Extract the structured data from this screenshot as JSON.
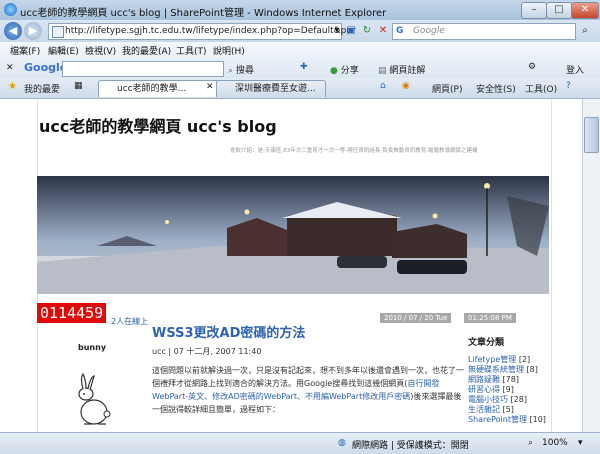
{
  "window": {
    "title": "ucc老師的教學網頁 ucc's blog | SharePoint管理 - Windows Internet Explorer"
  },
  "addressbar": {
    "url": "http://lifetype.sgjh.tc.edu.tw/lifetype/index.php?op=Default&por",
    "search_placeholder": "Google"
  },
  "gtoolbar": {
    "logo": "Google",
    "search_label": "搜尋",
    "share_label": "分享",
    "bookmark_label": "網頁註解",
    "login_label": "登入"
  },
  "menubar": [
    "檔案(F)",
    "編輯(E)",
    "檢視(V)",
    "我的最愛(A)",
    "工具(T)",
    "說明(H)"
  ],
  "favorites": {
    "label": "我的最愛",
    "tabs": [
      "ucc老師的教學...",
      "深圳醫療費至女遊..."
    ]
  },
  "commandbar": {
    "page_label": "網頁(P)",
    "safety_label": "安全性(S)",
    "tools_label": "工具(O)"
  },
  "blog": {
    "title": "ucc老師的教學網頁 ucc's blog",
    "author_note": "會飲介紹：是-天康區,63年次三重育才一次一等-現任資訊組長-負責推動資訊教育,電腦教導網頁之建構",
    "counter": "0114459",
    "online": "2人在線上",
    "date": "2010 / 07 / 20  Tue",
    "time": "01:25:08 PM",
    "avatar_name": "bunny"
  },
  "post": {
    "title": "WSS3更改AD密碼的方法",
    "meta": "ucc | 07 十二月, 2007 11:40",
    "body_1": "這個問題以前就解決過一次，只是沒有記起來，想不到多年以後還會遇到一次，也花了一個禮拜才從網路上找到適合的解決方法。用Google搜尋找到這幾個網頁(",
    "link_1": "自行開發WebPart-英文、修改AD密碼的WebPart、不用編WebPart修改用戶密碼",
    "body_2": ")後來選擇最後一個說得較詳細且簡單，過程如下："
  },
  "sidebar": {
    "heading": "文章分類",
    "categories": [
      {
        "name": "Lifetype管理",
        "count": "[2]"
      },
      {
        "name": "無硬碟系統管理",
        "count": "[8]"
      },
      {
        "name": "網路疑難",
        "count": "[78]"
      },
      {
        "name": "研習心得",
        "count": "[9]"
      },
      {
        "name": "電腦小技巧",
        "count": "[28]"
      },
      {
        "name": "生活雜記",
        "count": "[5]"
      },
      {
        "name": "SharePoint管理",
        "count": "[10]"
      }
    ]
  },
  "statusbar": {
    "zone": "網際網路 | 受保護模式：開閉",
    "zoom": "100%"
  }
}
